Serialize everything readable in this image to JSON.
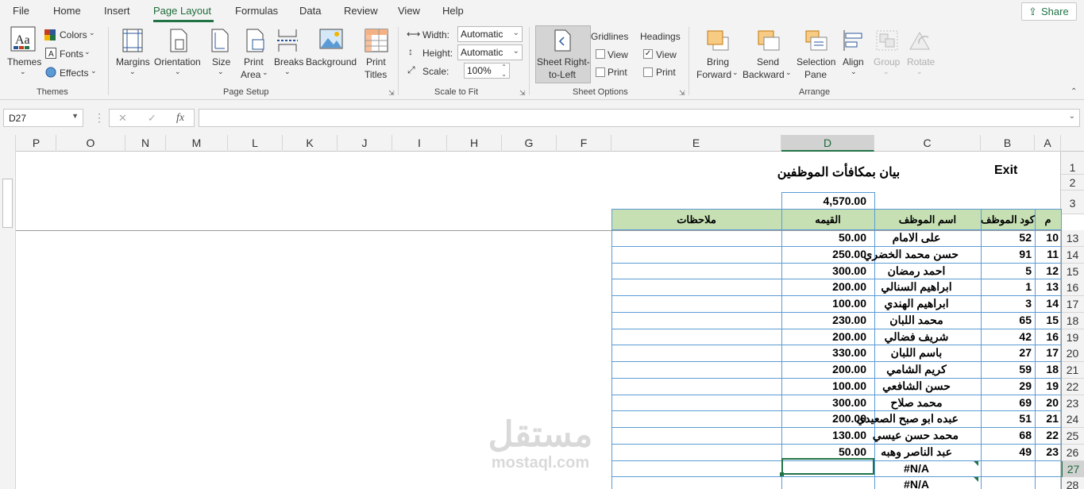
{
  "tabs": [
    "File",
    "Home",
    "Insert",
    "Page Layout",
    "Formulas",
    "Data",
    "Review",
    "View",
    "Help"
  ],
  "active_tab": "Page Layout",
  "share_label": "Share",
  "ribbon": {
    "themes": {
      "themes_label": "Themes",
      "colors_label": "Colors",
      "fonts_label": "Fonts",
      "effects_label": "Effects",
      "group_label": "Themes"
    },
    "page_setup": {
      "margins": "Margins",
      "orientation": "Orientation",
      "size": "Size",
      "print_area_1": "Print",
      "print_area_2": "Area",
      "breaks": "Breaks",
      "background": "Background",
      "print_titles_1": "Print",
      "print_titles_2": "Titles",
      "group_label": "Page Setup"
    },
    "scale_to_fit": {
      "width_label": "Width:",
      "width_value": "Automatic",
      "height_label": "Height:",
      "height_value": "Automatic",
      "scale_label": "Scale:",
      "scale_value": "100%",
      "group_label": "Scale to Fit"
    },
    "sheet_options": {
      "rtl_1": "Sheet Right-",
      "rtl_2": "to-Left",
      "gridlines": "Gridlines",
      "headings": "Headings",
      "view": "View",
      "print": "Print",
      "group_label": "Sheet Options"
    },
    "arrange": {
      "bring_1": "Bring",
      "bring_2": "Forward",
      "send_1": "Send",
      "send_2": "Backward",
      "sel_1": "Selection",
      "sel_2": "Pane",
      "align": "Align",
      "group": "Group",
      "rotate": "Rotate",
      "group_label": "Arrange"
    }
  },
  "formula_bar": {
    "name_box": "D27",
    "cancel": "✕",
    "enter": "✓",
    "fx": "fx",
    "content": ""
  },
  "columns": [
    "P",
    "O",
    "N",
    "M",
    "L",
    "K",
    "J",
    "I",
    "H",
    "G",
    "F",
    "E",
    "D",
    "C",
    "B",
    "A"
  ],
  "selected_column": "D",
  "rows": [
    "1",
    "2",
    "3",
    "13",
    "14",
    "15",
    "16",
    "17",
    "18",
    "19",
    "20",
    "21",
    "22",
    "23",
    "24",
    "25",
    "26",
    "27",
    "28"
  ],
  "selected_row": "27",
  "sheet": {
    "exit_label": "Exit",
    "title": "بيان بمكافأت الموظفين",
    "total": "4,570.00",
    "headers": {
      "num": "م",
      "code": "كود الموظف",
      "name": "اسم الموظف",
      "value": "القيمه",
      "notes": "ملاحظات"
    },
    "records": [
      {
        "num": "10",
        "code": "52",
        "name": "على الامام",
        "value": "50.00"
      },
      {
        "num": "11",
        "code": "91",
        "name": "حسن محمد الخضري",
        "value": "250.00"
      },
      {
        "num": "12",
        "code": "5",
        "name": "احمد رمضان",
        "value": "300.00"
      },
      {
        "num": "13",
        "code": "1",
        "name": "ابراهيم السنالي",
        "value": "200.00"
      },
      {
        "num": "14",
        "code": "3",
        "name": "ابراهيم الهندي",
        "value": "100.00"
      },
      {
        "num": "15",
        "code": "65",
        "name": "محمد اللبان",
        "value": "230.00"
      },
      {
        "num": "16",
        "code": "42",
        "name": "شريف فضالي",
        "value": "200.00"
      },
      {
        "num": "17",
        "code": "27",
        "name": "باسم اللبان",
        "value": "330.00"
      },
      {
        "num": "18",
        "code": "59",
        "name": "كريم الشامي",
        "value": "200.00"
      },
      {
        "num": "19",
        "code": "29",
        "name": "حسن الشافعي",
        "value": "100.00"
      },
      {
        "num": "20",
        "code": "69",
        "name": "محمد صلاح",
        "value": "300.00"
      },
      {
        "num": "21",
        "code": "51",
        "name": "عبده ابو صبح الصعيدي",
        "value": "200.00"
      },
      {
        "num": "22",
        "code": "68",
        "name": "محمد حسن عيسي",
        "value": "130.00"
      },
      {
        "num": "23",
        "code": "49",
        "name": "عبد الناصر وهبه",
        "value": "50.00"
      }
    ],
    "na_rows": [
      {
        "name": "#N/A"
      },
      {
        "name": "#N/A"
      }
    ]
  },
  "watermark": {
    "arabic": "مستقل",
    "latin": "mostaql.com"
  },
  "colors": {
    "accent": "#217346",
    "header_fill": "#c6e0b4",
    "border_blue": "#5b9bd5"
  }
}
